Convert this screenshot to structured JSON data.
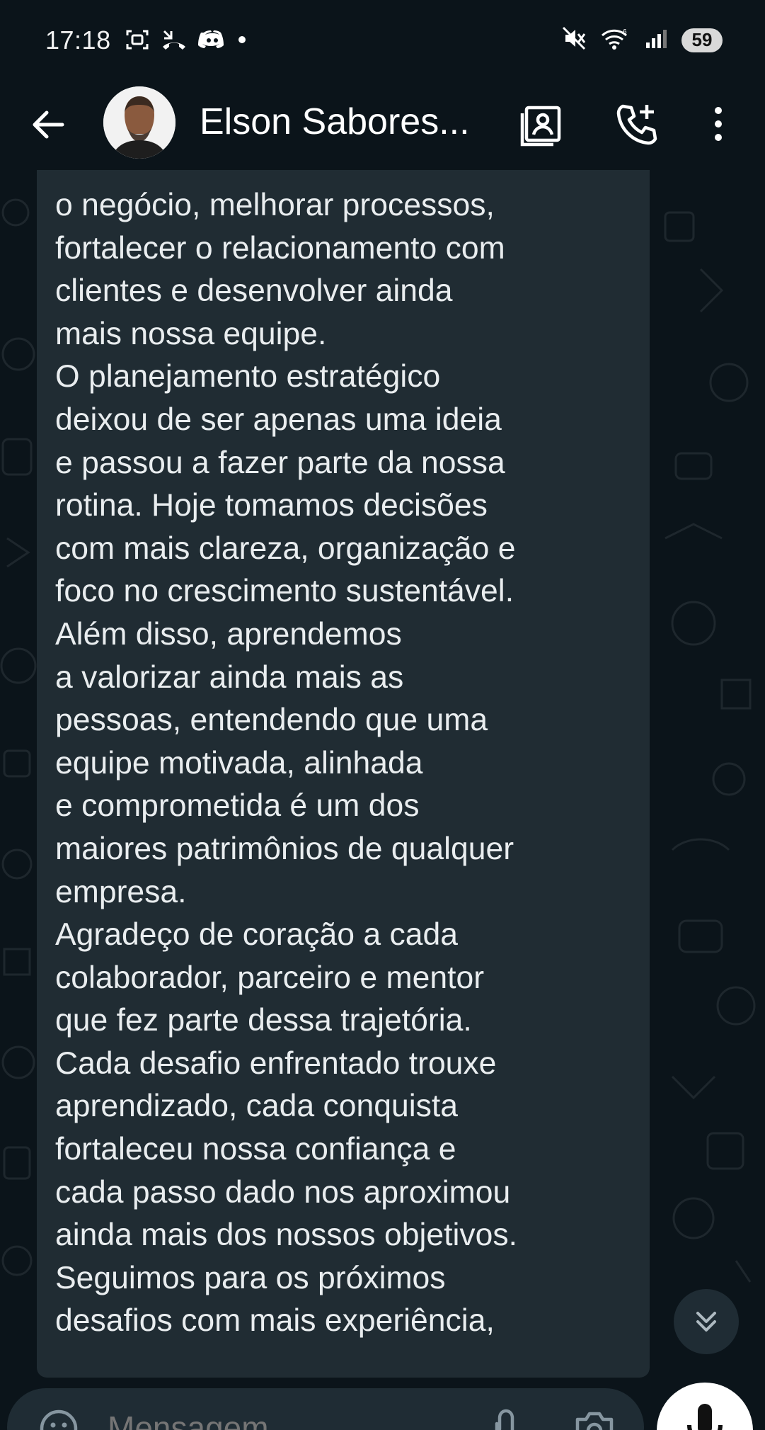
{
  "status_bar": {
    "time": "17:18",
    "battery": "59",
    "left_icons": [
      "screenshot-icon",
      "missed-call-icon",
      "discord-icon",
      "dot-icon"
    ],
    "right_icons": [
      "mute-icon",
      "wifi-icon",
      "signal-icon"
    ]
  },
  "header": {
    "contact_name": "Elson Sabores...",
    "back_icon": "arrow-left-icon",
    "icons": [
      "contact-card-icon",
      "add-call-icon",
      "more-vert-icon"
    ]
  },
  "message": {
    "lines": [
      "o negócio, melhorar processos,",
      "fortalecer o relacionamento com",
      "clientes e desenvolver ainda",
      "mais nossa equipe.",
      "O planejamento estratégico",
      "deixou de ser apenas uma ideia",
      "e passou a fazer parte da nossa",
      "rotina. Hoje tomamos decisões",
      "com mais clareza, organização e",
      "foco no crescimento sustentável.",
      "Além disso, aprendemos",
      "a valorizar ainda mais as",
      "pessoas, entendendo que uma",
      "equipe motivada, alinhada",
      "e comprometida é um dos",
      "maiores patrimônios de qualquer",
      "empresa.",
      "Agradeço de coração a cada",
      "colaborador, parceiro e mentor",
      "que fez parte dessa trajetória.",
      "Cada desafio enfrentado trouxe",
      "aprendizado, cada conquista",
      "fortaleceu nossa confiança e",
      "cada passo dado nos aproximou",
      "ainda mais dos nossos objetivos.",
      "Seguimos para os próximos",
      "desafios com mais experiência,"
    ]
  },
  "composer": {
    "placeholder": "Mensagem",
    "icons": [
      "emoji-icon",
      "attach-icon",
      "camera-icon",
      "mic-icon"
    ]
  },
  "colors": {
    "background": "#0b141a",
    "bubble": "#202c33",
    "text": "#e9edef",
    "muted": "#8696a0"
  }
}
